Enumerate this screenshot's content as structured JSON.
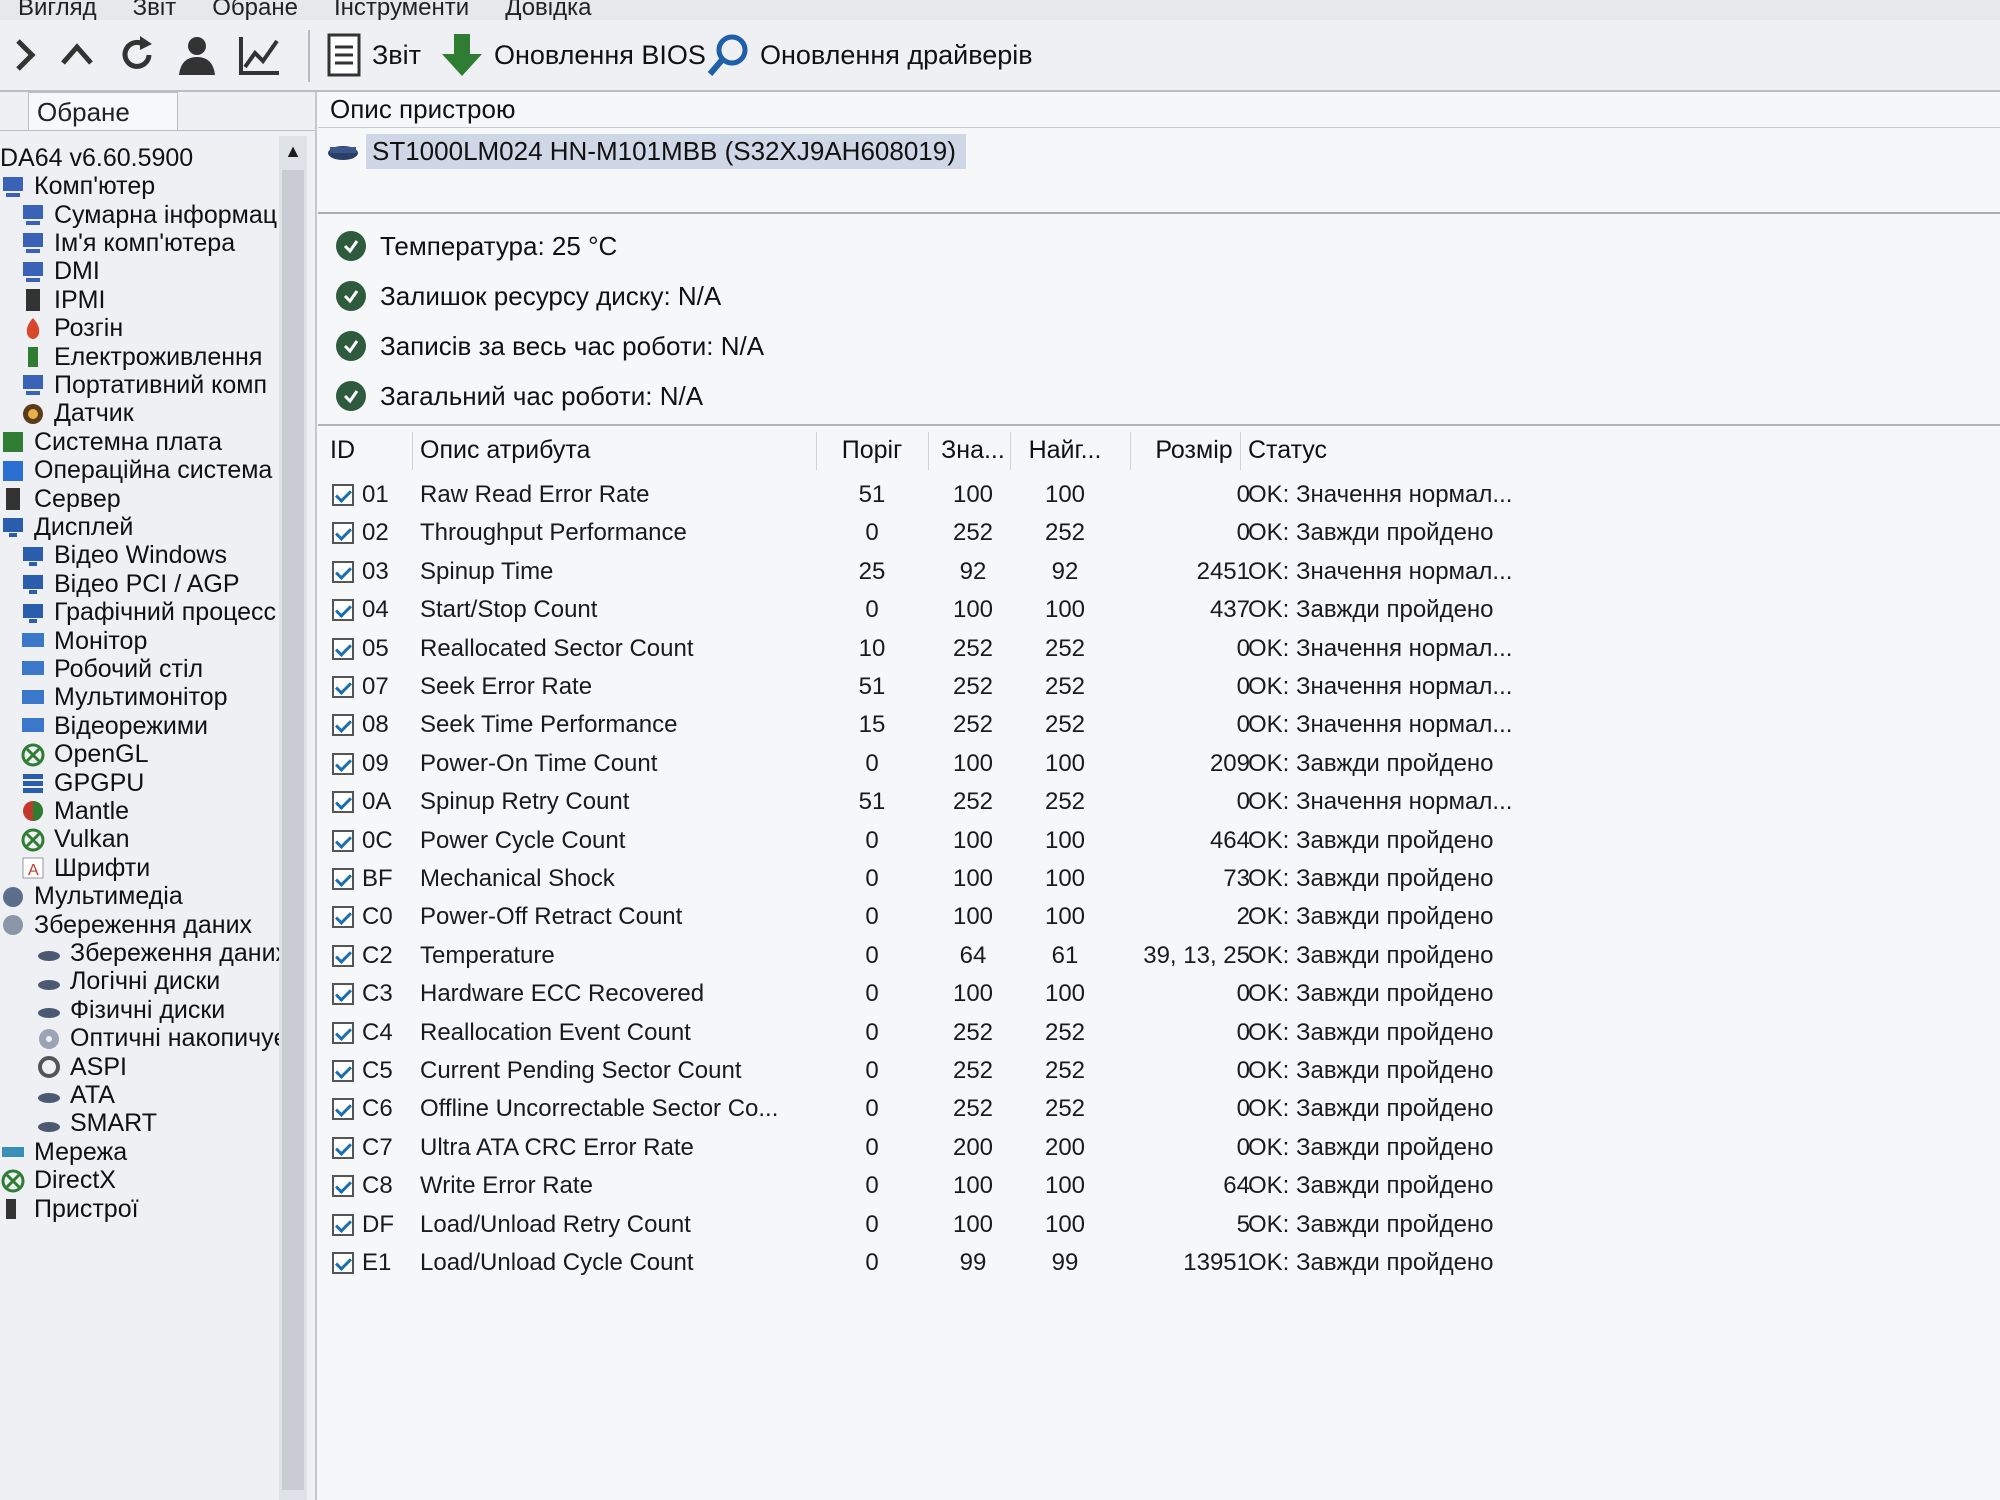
{
  "menu": [
    "Вигляд",
    "Звіт",
    "Обране",
    "Інструменти",
    "Довідка"
  ],
  "toolbar": {
    "report_label": "Звіт",
    "bios_label": "Оновлення BIOS",
    "drivers_label": "Оновлення драйверів"
  },
  "sidebar": {
    "tab_label": "Обране",
    "items": [
      {
        "label": "DA64 v6.60.5900",
        "indent": 0,
        "icon": "none"
      },
      {
        "label": "Комп'ютер",
        "indent": 0,
        "icon": "computer-icon"
      },
      {
        "label": "Сумарна інформац",
        "indent": 1,
        "icon": "computer-icon"
      },
      {
        "label": "Ім'я комп'ютера",
        "indent": 1,
        "icon": "computer-icon"
      },
      {
        "label": "DMI",
        "indent": 1,
        "icon": "computer-icon"
      },
      {
        "label": "IPMI",
        "indent": 1,
        "icon": "server-icon"
      },
      {
        "label": "Розгін",
        "indent": 1,
        "icon": "flame-icon"
      },
      {
        "label": "Електроживлення",
        "indent": 1,
        "icon": "battery-icon"
      },
      {
        "label": "Портативний комп",
        "indent": 1,
        "icon": "computer-icon"
      },
      {
        "label": "Датчик",
        "indent": 1,
        "icon": "sensor-icon"
      },
      {
        "label": "Системна плата",
        "indent": 0,
        "icon": "motherboard-icon"
      },
      {
        "label": "Операційна система",
        "indent": 0,
        "icon": "os-icon"
      },
      {
        "label": "Сервер",
        "indent": 0,
        "icon": "server-icon"
      },
      {
        "label": "Дисплей",
        "indent": 0,
        "icon": "display-icon"
      },
      {
        "label": "Відео Windows",
        "indent": 1,
        "icon": "display-icon"
      },
      {
        "label": "Відео PCI / AGP",
        "indent": 1,
        "icon": "display-icon"
      },
      {
        "label": "Графічний процесс",
        "indent": 1,
        "icon": "display-icon"
      },
      {
        "label": "Монітор",
        "indent": 1,
        "icon": "monitor-icon"
      },
      {
        "label": "Робочий стіл",
        "indent": 1,
        "icon": "monitor-icon"
      },
      {
        "label": "Мультимонітор",
        "indent": 1,
        "icon": "monitor-icon"
      },
      {
        "label": "Відеорежими",
        "indent": 1,
        "icon": "monitor-icon"
      },
      {
        "label": "OpenGL",
        "indent": 1,
        "icon": "xbox-icon"
      },
      {
        "label": "GPGPU",
        "indent": 1,
        "icon": "stack-icon"
      },
      {
        "label": "Mantle",
        "indent": 1,
        "icon": "mantle-icon"
      },
      {
        "label": "Vulkan",
        "indent": 1,
        "icon": "xbox-icon"
      },
      {
        "label": "Шрифти",
        "indent": 1,
        "icon": "font-icon"
      },
      {
        "label": "Мультимедіа",
        "indent": 0,
        "icon": "multimedia-icon"
      },
      {
        "label": "Збереження даних",
        "indent": 0,
        "icon": "storage-icon"
      },
      {
        "label": "Збереження даних",
        "indent": 2,
        "icon": "drive-icon"
      },
      {
        "label": "Логічні диски",
        "indent": 2,
        "icon": "drive-icon"
      },
      {
        "label": "Фізичні диски",
        "indent": 2,
        "icon": "drive-icon"
      },
      {
        "label": "Оптичні накопичує",
        "indent": 2,
        "icon": "disc-icon"
      },
      {
        "label": "ASPI",
        "indent": 2,
        "icon": "aspi-icon"
      },
      {
        "label": "ATA",
        "indent": 2,
        "icon": "drive-icon"
      },
      {
        "label": "SMART",
        "indent": 2,
        "icon": "drive-icon"
      },
      {
        "label": "Мережа",
        "indent": 0,
        "icon": "network-icon"
      },
      {
        "label": "DirectX",
        "indent": 0,
        "icon": "xbox-icon"
      },
      {
        "label": "Пристрої",
        "indent": 0,
        "icon": "devices-icon"
      }
    ]
  },
  "description": {
    "header": "Опис пристрою",
    "device": "ST1000LM024 HN-M101MBB (S32XJ9AH608019)"
  },
  "status_lines": [
    "Температура: 25 °C",
    "Залишок ресурсу диску: N/A",
    "Записів за весь час роботи: N/A",
    "Загальний час роботи: N/A"
  ],
  "table": {
    "headers": [
      "ID",
      "Опис атрибута",
      "Поріг",
      "Зна...",
      "Найг...",
      "Розмір",
      "Статус"
    ],
    "rows": [
      [
        "01",
        "Raw Read Error Rate",
        "51",
        "100",
        "100",
        "0",
        "OK: Значення нормал..."
      ],
      [
        "02",
        "Throughput Performance",
        "0",
        "252",
        "252",
        "0",
        "OK: Завжди пройдено"
      ],
      [
        "03",
        "Spinup Time",
        "25",
        "92",
        "92",
        "2451",
        "OK: Значення нормал..."
      ],
      [
        "04",
        "Start/Stop Count",
        "0",
        "100",
        "100",
        "437",
        "OK: Завжди пройдено"
      ],
      [
        "05",
        "Reallocated Sector Count",
        "10",
        "252",
        "252",
        "0",
        "OK: Значення нормал..."
      ],
      [
        "07",
        "Seek Error Rate",
        "51",
        "252",
        "252",
        "0",
        "OK: Значення нормал..."
      ],
      [
        "08",
        "Seek Time Performance",
        "15",
        "252",
        "252",
        "0",
        "OK: Значення нормал..."
      ],
      [
        "09",
        "Power-On Time Count",
        "0",
        "100",
        "100",
        "209",
        "OK: Завжди пройдено"
      ],
      [
        "0A",
        "Spinup Retry Count",
        "51",
        "252",
        "252",
        "0",
        "OK: Значення нормал..."
      ],
      [
        "0C",
        "Power Cycle Count",
        "0",
        "100",
        "100",
        "464",
        "OK: Завжди пройдено"
      ],
      [
        "BF",
        "Mechanical Shock",
        "0",
        "100",
        "100",
        "73",
        "OK: Завжди пройдено"
      ],
      [
        "C0",
        "Power-Off Retract Count",
        "0",
        "100",
        "100",
        "2",
        "OK: Завжди пройдено"
      ],
      [
        "C2",
        "Temperature",
        "0",
        "64",
        "61",
        "39, 13, 25",
        "OK: Завжди пройдено"
      ],
      [
        "C3",
        "Hardware ECC Recovered",
        "0",
        "100",
        "100",
        "0",
        "OK: Завжди пройдено"
      ],
      [
        "C4",
        "Reallocation Event Count",
        "0",
        "252",
        "252",
        "0",
        "OK: Завжди пройдено"
      ],
      [
        "C5",
        "Current Pending Sector Count",
        "0",
        "252",
        "252",
        "0",
        "OK: Завжди пройдено"
      ],
      [
        "C6",
        "Offline Uncorrectable Sector Co...",
        "0",
        "252",
        "252",
        "0",
        "OK: Завжди пройдено"
      ],
      [
        "C7",
        "Ultra ATA CRC Error Rate",
        "0",
        "200",
        "200",
        "0",
        "OK: Завжди пройдено"
      ],
      [
        "C8",
        "Write Error Rate",
        "0",
        "100",
        "100",
        "64",
        "OK: Завжди пройдено"
      ],
      [
        "DF",
        "Load/Unload Retry Count",
        "0",
        "100",
        "100",
        "5",
        "OK: Завжди пройдено"
      ],
      [
        "E1",
        "Load/Unload Cycle Count",
        "0",
        "99",
        "99",
        "13951",
        "OK: Завжди пройдено"
      ]
    ]
  },
  "colors": {
    "selection": "#cfd6e6",
    "ok_icon": "#2e5a3e",
    "toolbar_green": "#2f7d32",
    "toolbar_blue": "#1f5fa8"
  }
}
